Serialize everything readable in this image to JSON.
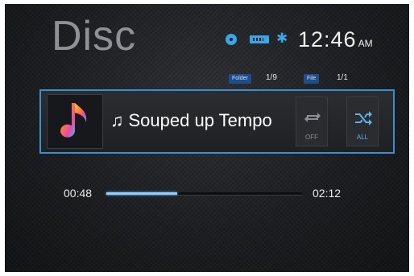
{
  "header": {
    "title": "Disc",
    "status_icons": [
      "disc-icon",
      "usb-icon",
      "bluetooth-icon"
    ],
    "clock": {
      "time": "12:46",
      "meridiem": "AM"
    }
  },
  "counters": {
    "folder_label": "Folder",
    "folder_value": "1/9",
    "file_label": "File",
    "file_value": "1/1"
  },
  "track": {
    "note_icon": "music-note-icon",
    "name": "Souped up Tempo",
    "repeat": {
      "icon": "repeat-icon",
      "label": "OFF"
    },
    "shuffle": {
      "icon": "shuffle-icon",
      "label": "ALL"
    }
  },
  "playback": {
    "elapsed": "00:48",
    "total": "02:12",
    "progress_fraction": 0.364
  },
  "colors": {
    "accent": "#3aa6e8",
    "progress": "#8fd0ff",
    "panel_border": "#3c8fd0"
  }
}
